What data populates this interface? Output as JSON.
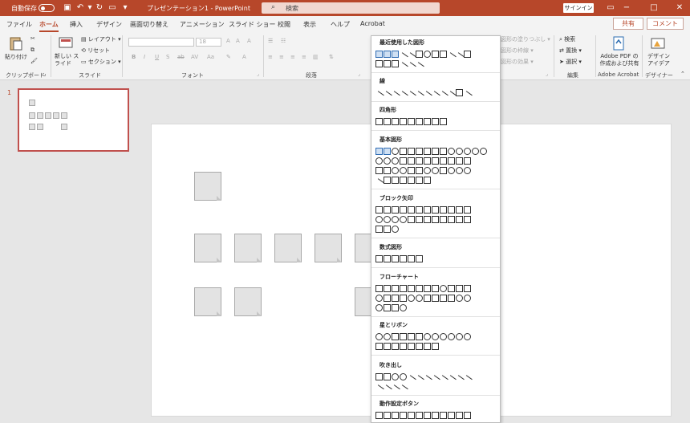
{
  "titlebar": {
    "autosave": "自動保存",
    "title": "プレゼンテーション1 - PowerPoint",
    "search_placeholder": "検索",
    "signin": "サインイン",
    "minimize": "−",
    "restore": "□",
    "close": "✕",
    "ribbon_display": "▭"
  },
  "tabs": [
    "ファイル",
    "ホーム",
    "挿入",
    "デザイン",
    "画面切り替え",
    "アニメーション",
    "スライド ショー",
    "校閲",
    "表示",
    "ヘルプ",
    "Acrobat"
  ],
  "actions": {
    "share": "共有",
    "comment": "コメント"
  },
  "ribbon": {
    "clipboard": {
      "paste": "貼り付け",
      "label": "クリップボード"
    },
    "slides": {
      "new_slide": "新しい スライド",
      "layout": "レイアウト",
      "reset": "リセット",
      "section": "セクション",
      "label": "スライド"
    },
    "font": {
      "size": "18",
      "label": "フォント"
    },
    "paragraph": {
      "label": "段落"
    },
    "drawing": {
      "fill": "図形の塗りつぶし",
      "outline": "図形の枠線",
      "effects": "図形の効果"
    },
    "editing": {
      "find": "検索",
      "replace": "置換",
      "select": "選択",
      "label": "編集"
    },
    "acrobat": {
      "create": "Adobe PDF の 作成および共有",
      "label": "Adobe Acrobat"
    },
    "designer": {
      "ideas": "デザイン アイデア",
      "label": "デザイナー"
    }
  },
  "thumbnails": {
    "slide_number": "1"
  },
  "shapes_menu": {
    "sections": [
      "最近使用した図形",
      "線",
      "四角形",
      "基本図形",
      "ブロック矢印",
      "数式図形",
      "フローチャート",
      "星とリボン",
      "吹き出し",
      "動作設定ボタン"
    ]
  }
}
